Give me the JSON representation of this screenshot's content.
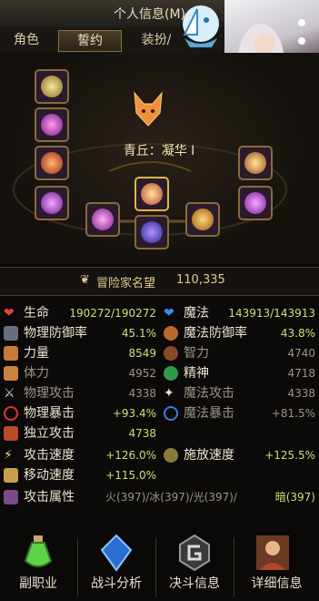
{
  "window": {
    "title": "个人信息(M)"
  },
  "tabs": [
    {
      "label": "角色"
    },
    {
      "label": "誓约"
    },
    {
      "label": "装扮/"
    }
  ],
  "pact": {
    "name": "青丘：凝华 I"
  },
  "fame": {
    "label": "冒险家名望",
    "value": "110,335"
  },
  "stats": [
    {
      "label": "生命",
      "value": "190272/190272",
      "color": "#c8e07a"
    },
    {
      "label": "魔法",
      "value": "143913/143913",
      "color": "#c8e07a"
    },
    {
      "label": "物理防御率",
      "value": "45.1%",
      "color": "#c8e07a"
    },
    {
      "label": "魔法防御率",
      "value": "43.8%",
      "color": "#c8e07a"
    },
    {
      "label": "力量",
      "value": "8549",
      "color": "#c8e07a"
    },
    {
      "label": "智力",
      "value": "4740",
      "color": "#9c9586"
    },
    {
      "label": "体力",
      "value": "4952",
      "color": "#9c9586"
    },
    {
      "label": "精神",
      "value": "4718",
      "color": "#9c9586"
    },
    {
      "label": "物理攻击",
      "value": "4338",
      "color": "#9c9586"
    },
    {
      "label": "魔法攻击",
      "value": "4338",
      "color": "#9c9586"
    },
    {
      "label": "物理暴击",
      "value": "+93.4%",
      "color": "#c8e07a"
    },
    {
      "label": "魔法暴击",
      "value": "+81.5%",
      "color": "#9c9586"
    },
    {
      "label": "独立攻击",
      "value": "4738",
      "color": "#c8e07a"
    },
    {
      "label": "攻击速度",
      "value": "+126.0%",
      "color": "#c8e07a"
    },
    {
      "label": "施放速度",
      "value": "+125.5%",
      "color": "#c8e07a"
    },
    {
      "label": "移动速度",
      "value": "+115.0%",
      "color": "#c8e07a"
    }
  ],
  "attack_attr": {
    "label": "攻击属性",
    "value_a": "火(397)/冰(397)/光(397)/",
    "value_b": "暗(397)"
  },
  "bottom_buttons": [
    {
      "label": "副职业"
    },
    {
      "label": "战斗分析"
    },
    {
      "label": "决斗信息"
    },
    {
      "label": "详细信息"
    }
  ],
  "colors": {
    "accent": "#d9b36a",
    "green": "#c8e07a",
    "gray": "#9c9586"
  }
}
